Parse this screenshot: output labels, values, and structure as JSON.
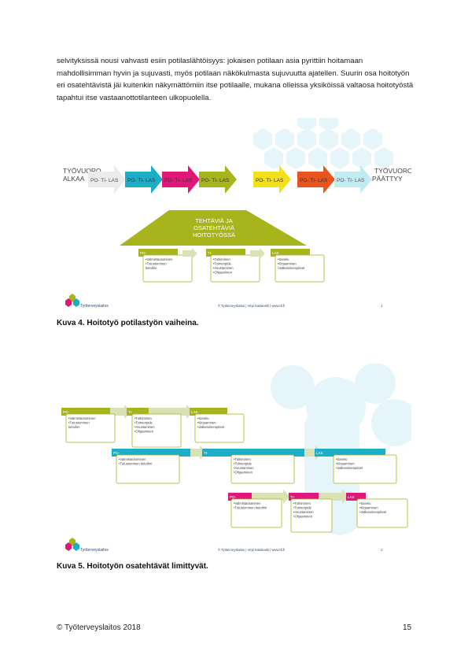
{
  "body_text": "selvityksissä nousi vahvasti esiin potilaslähtöisyys: jokaisen potilaan asia pyrittiin hoitamaan mahdollisimman hyvin ja sujuvasti, myös potilaan näkökulmasta sujuvuutta ajatellen. Suurin osa hoitotyön eri osatehtävistä jäi kuitenkin näkymättömiin itse potilaalle, mukana olleissa yksiköissä valtaosa hoitotyöstä tapahtui itse vastaanottotilanteen ulkopuolella.",
  "figure1": {
    "start_label": [
      "TYÖVUORO",
      "ALKAA"
    ],
    "end_label": [
      "TYÖVUORO",
      "PÄÄTTYY"
    ],
    "arrows": [
      {
        "label": "PO-   TI-   LAS",
        "color": "#ececec"
      },
      {
        "label": "PO-   TI-   LAS",
        "color": "#1aafc7"
      },
      {
        "label": "PO-   TI-   LAS",
        "color": "#e0187a"
      },
      {
        "label": "PO-   TI-   LAS",
        "color": "#a8b41b"
      },
      {
        "label": "PO-   TI-   LAS",
        "color": "#f4e11a"
      },
      {
        "label": "PO-   TI-   LAS",
        "color": "#e9531e"
      },
      {
        "label": "PO-   TI-   LAS",
        "color": "#c2ecf2"
      }
    ],
    "trapezoid_text": [
      "TEHTÄVIÄ JA",
      "OSATEHTÄVIÄ",
      "HOITOTYÖSSÄ"
    ],
    "boxes": [
      {
        "head": "PO-",
        "items": [
          "•Valmistautuminen",
          "•Tutustuminen",
          "  tietoihin"
        ]
      },
      {
        "head": "TI-",
        "items": [
          "•Tutkiminen",
          "•Toimenpide",
          "•Avustaminen",
          "•Ohjaaminen"
        ]
      },
      {
        "head": "LAS",
        "items": [
          "•Sanelu",
          "•Kirjaaminen",
          "•Jatkotoimenpiteet"
        ]
      }
    ],
    "logo_text": "Työterveyslaitos",
    "footer_center": "© Työterveyslaitos   |   Virpi Kalakoski   |   www.ttl.fi",
    "slide_number": "1"
  },
  "caption1": "Kuva 4. Hoitotyö potilastyön vaiheina.",
  "figure2": {
    "rows": [
      {
        "head_color": "#a8b41b",
        "boxes": [
          {
            "head": "PO-",
            "items": [
              "•Valmistautuminen",
              "•Tutustuminen",
              "  tietoihin"
            ]
          },
          {
            "head": "TI-",
            "items": [
              "•Tutkiminen",
              "•Toimenpide",
              "•Avustaminen",
              "•Ohjaaminen"
            ]
          },
          {
            "head": "LAS",
            "items": [
              "•Sanelu",
              "•Kirjaaminen",
              "•Jatkotoimenpiteet"
            ]
          }
        ]
      },
      {
        "head_color": "#1aafc7",
        "boxes": [
          {
            "head": "PO-",
            "items": [
              "•Valmistautuminen",
              "•Tutustuminen  tietoihin"
            ]
          },
          {
            "head": "TI-",
            "items": [
              "•Tutkiminen",
              "•Toimenpide",
              "•Avustaminen",
              "•Ohjaaminen"
            ]
          },
          {
            "head": "LAS",
            "items": [
              "•Sanelu",
              "•Kirjaaminen",
              "•Jatkotoimenpiteet"
            ]
          }
        ]
      },
      {
        "head_color": "#e0187a",
        "boxes": [
          {
            "head": "PO-",
            "items": [
              "•Valmistautuminen",
              "•Tutustuminen  tietoihin"
            ]
          },
          {
            "head": "TI-",
            "items": [
              "•Tutkiminen",
              "•Toimenpide",
              "•Avustaminen",
              "•Ohjaaminen"
            ]
          },
          {
            "head": "LAS",
            "items": [
              "•Sanelu",
              "•Kirjaaminen",
              "•Jatkotoimenpiteet"
            ]
          }
        ]
      }
    ],
    "logo_text": "Työterveyslaitos",
    "footer_center": "© Työterveyslaitos   |   Virpi Kalakoski   |   www.ttl.fi",
    "slide_number": "2"
  },
  "caption2": "Kuva 5. Hoitotyön osatehtävät limittyvät.",
  "footer": {
    "copyright": "© Työterveyslaitos 2018",
    "page_number": "15"
  }
}
